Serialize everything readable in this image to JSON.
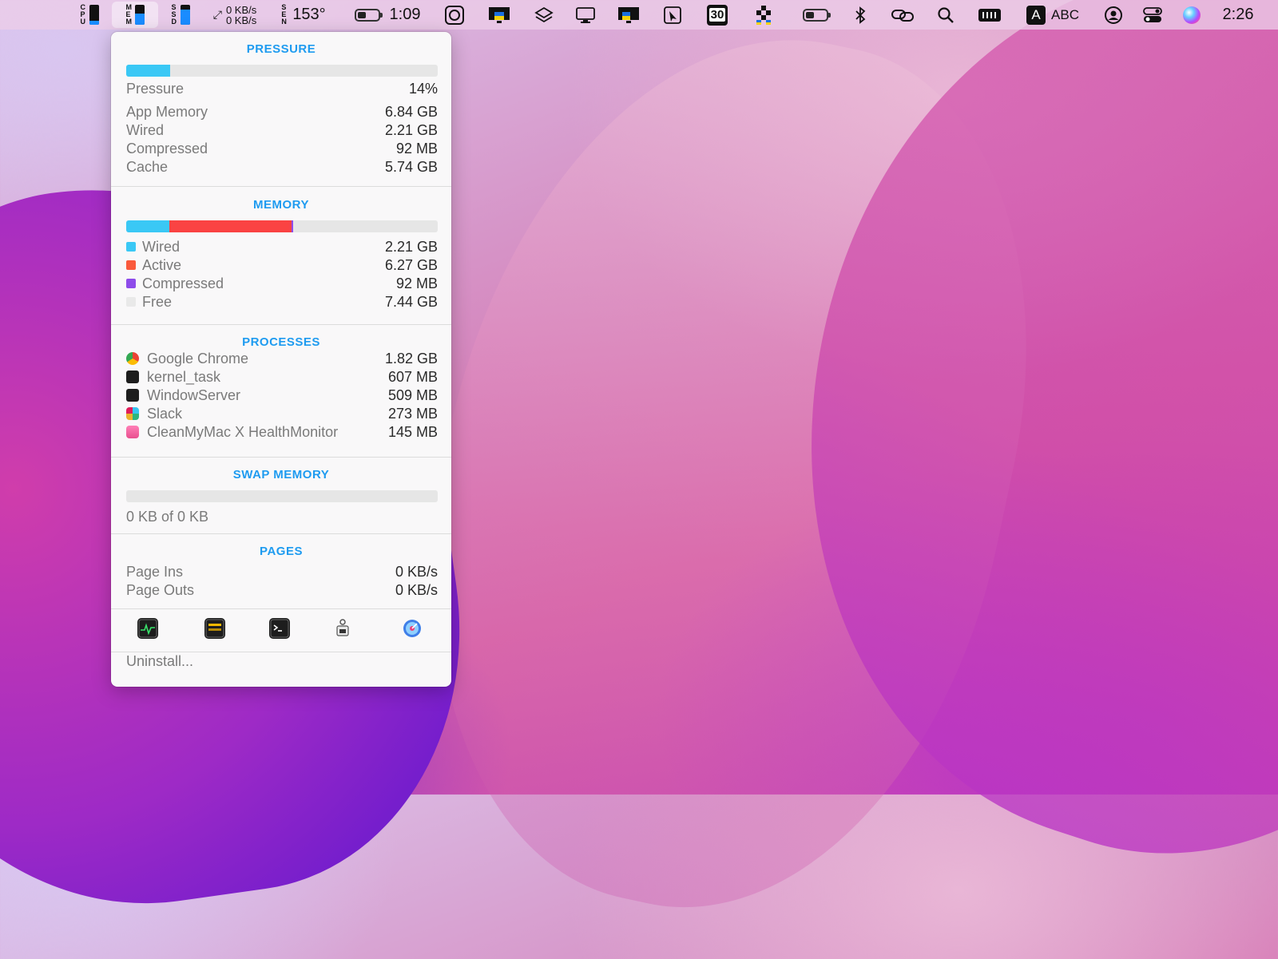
{
  "menubar": {
    "cpu_label": "CPU",
    "mem_label": "MEM",
    "ssd_label": "SSD",
    "cpu_level": 0.2,
    "mem_level": 0.55,
    "ssd_level": 0.75,
    "net_up": "0 KB/s",
    "net_down": "0 KB/s",
    "sensor_label": "SEN",
    "sensor_value": "153°",
    "battery_time": "1:09",
    "battery_level": 0.45,
    "calendar_day": "30",
    "battery2_level": 0.4,
    "input_source_letter": "A",
    "input_source": "ABC",
    "clock": "2:26",
    "icons": [
      "screenshot-icon",
      "monitor-flag-icon",
      "layers-icon",
      "display-icon",
      "monitor-flag-icon",
      "pointer-icon",
      "calendar-icon",
      "bartender-icon",
      "battery-icon",
      "bluetooth-icon",
      "link-icon",
      "search-icon",
      "memory-chip-icon",
      "input-source-icon",
      "user-icon",
      "control-center-icon",
      "siri-icon"
    ]
  },
  "popup": {
    "pressure": {
      "title": "PRESSURE",
      "level": 0.14,
      "rows": [
        {
          "label": "Pressure",
          "value": "14%"
        },
        {
          "label": "App Memory",
          "value": "6.84 GB"
        },
        {
          "label": "Wired",
          "value": "2.21 GB"
        },
        {
          "label": "Compressed",
          "value": "92 MB"
        },
        {
          "label": "Cache",
          "value": "5.74 GB"
        }
      ]
    },
    "memory": {
      "title": "MEMORY",
      "segments": [
        {
          "name": "Wired",
          "fraction": 0.138,
          "color": "#3ac8f5"
        },
        {
          "name": "Active",
          "fraction": 0.392,
          "color": "#fa4343"
        },
        {
          "name": "Compressed",
          "fraction": 0.006,
          "color": "#8e4cea"
        }
      ],
      "rows": [
        {
          "label": "Wired",
          "value": "2.21 GB",
          "color": "#3ac8f5"
        },
        {
          "label": "Active",
          "value": "6.27 GB",
          "color": "#fa5a3c"
        },
        {
          "label": "Compressed",
          "value": "92 MB",
          "color": "#8e4cea"
        },
        {
          "label": "Free",
          "value": "7.44 GB",
          "color": "#e9e9e9"
        }
      ]
    },
    "processes": {
      "title": "PROCESSES",
      "rows": [
        {
          "label": "Google Chrome",
          "value": "1.82 GB",
          "icon": "chrome-icon"
        },
        {
          "label": "kernel_task",
          "value": "607 MB",
          "icon": "terminal-icon"
        },
        {
          "label": "WindowServer",
          "value": "509 MB",
          "icon": "terminal-icon"
        },
        {
          "label": "Slack",
          "value": "273 MB",
          "icon": "slack-icon"
        },
        {
          "label": "CleanMyMac X HealthMonitor",
          "value": "145 MB",
          "icon": "cleanmymac-icon"
        }
      ]
    },
    "swap": {
      "title": "SWAP MEMORY",
      "level": 0,
      "summary": "0 KB of 0 KB"
    },
    "pages": {
      "title": "PAGES",
      "rows": [
        {
          "label": "Page Ins",
          "value": "0 KB/s"
        },
        {
          "label": "Page Outs",
          "value": "0 KB/s"
        }
      ]
    },
    "tools": [
      "activity-monitor-icon",
      "console-icon",
      "terminal-icon",
      "system-info-icon",
      "disk-utility-icon"
    ],
    "uninstall": "Uninstall..."
  }
}
